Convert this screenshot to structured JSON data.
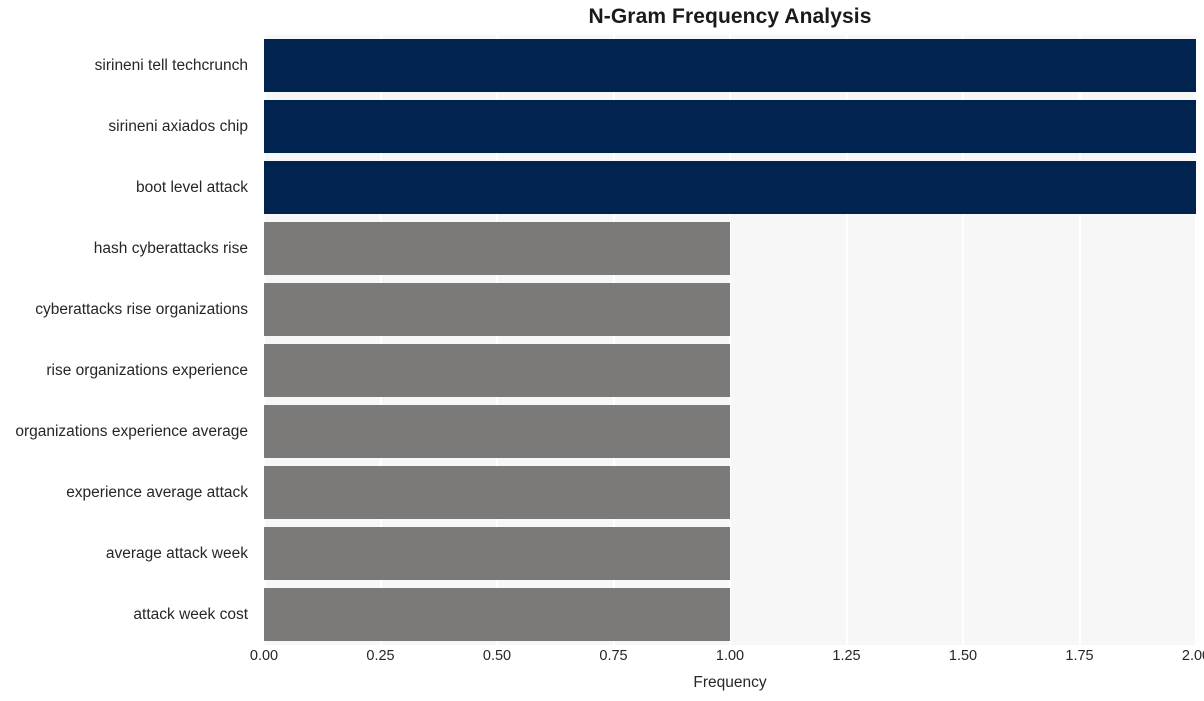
{
  "chart_data": {
    "type": "bar",
    "orientation": "horizontal",
    "title": "N-Gram Frequency Analysis",
    "xlabel": "Frequency",
    "ylabel": "",
    "xlim": [
      0.0,
      2.0
    ],
    "xticks": [
      "0.00",
      "0.25",
      "0.50",
      "0.75",
      "1.00",
      "1.25",
      "1.50",
      "1.75",
      "2.00"
    ],
    "xtick_values": [
      0.0,
      0.25,
      0.5,
      0.75,
      1.0,
      1.25,
      1.5,
      1.75,
      2.0
    ],
    "grid": true,
    "grid_color": "#ffffff",
    "plot_background": "#f7f7f7",
    "legend": null,
    "categories": [
      "sirineni tell techcrunch",
      "sirineni axiados chip",
      "boot level attack",
      "hash cyberattacks rise",
      "cyberattacks rise organizations",
      "rise organizations experience",
      "organizations experience average",
      "experience average attack",
      "average attack week",
      "attack week cost"
    ],
    "values": [
      2,
      2,
      2,
      1,
      1,
      1,
      1,
      1,
      1,
      1
    ],
    "bar_colors": [
      "#00234f",
      "#00234f",
      "#00234f",
      "#7b7a78",
      "#7b7a78",
      "#7b7a78",
      "#7b7a78",
      "#7b7a78",
      "#7b7a78",
      "#7b7a78"
    ]
  },
  "colors": {
    "highlight": "#00234f",
    "muted": "#7b7a78",
    "plot_bg": "#f7f7f7",
    "grid": "#ffffff",
    "text": "#262626",
    "title": "#1a1a1a"
  }
}
